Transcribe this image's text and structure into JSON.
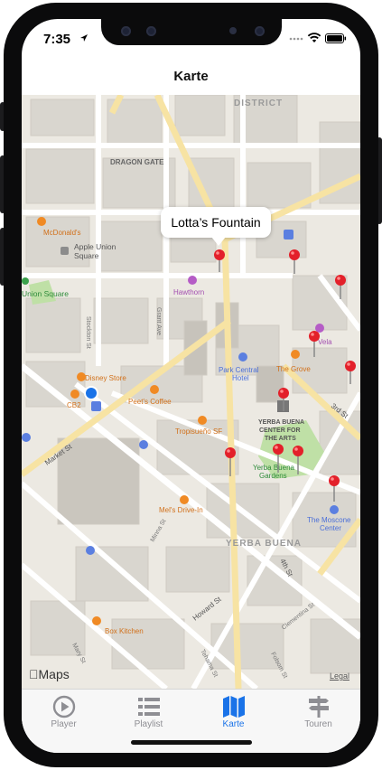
{
  "status_bar": {
    "time": "7:35"
  },
  "nav": {
    "title": "Karte"
  },
  "map": {
    "callout": "Lotta’s Fountain",
    "labels": {
      "district": "DISTRICT",
      "dragon_gate": "DRAGON GATE",
      "mcdonalds": "McDonald's",
      "apple_union_1": "Apple Union",
      "apple_union_2": "Square",
      "union_square": "Union Square",
      "hawthorn": "Hawthorn",
      "grant_ave": "Grant Ave",
      "stockton_st": "Stockton St",
      "park_central_1": "Park Central",
      "park_central_2": "Hotel",
      "the_grove": "The Grove",
      "vela": "Vela",
      "disney_store": "Disney Store",
      "cb2": "CB2",
      "peets": "Peet's Coffee",
      "tropisueno": "Tropisueño SF",
      "ybca_1": "YERBA BUENA",
      "ybca_2": "CENTER FOR",
      "ybca_3": "THE ARTS",
      "ybg_1": "Yerba Buena",
      "ybg_2": "Gardens",
      "third_st": "3rd St",
      "market_st": "Market St",
      "mels": "Mel's Drive-In",
      "yerba_buena": "YERBA BUENA",
      "moscone_1": "The Moscone",
      "moscone_2": "Center",
      "minna_st": "Minna St",
      "fourth_st": "4th St",
      "howard_st": "Howard St",
      "clementina_st": "Clementina St",
      "box_kitchen": "Box Kitchen",
      "mary_st": "Mary St",
      "tehama_st": "Tehama St",
      "folsom_st": "Folsom St"
    },
    "maps_logo": "Maps",
    "legal": "Legal"
  },
  "tabs": [
    {
      "label": "Player",
      "icon": "play-circle-icon",
      "active": false
    },
    {
      "label": "Playlist",
      "icon": "list-icon",
      "active": false
    },
    {
      "label": "Karte",
      "icon": "map-icon",
      "active": true
    },
    {
      "label": "Touren",
      "icon": "signpost-icon",
      "active": false
    }
  ],
  "colors": {
    "accent": "#1a73e8",
    "pin": "#e3202a",
    "inactive_tab": "#8e8e93",
    "park": "#bfe0a6",
    "road_major": "#f7e3a3"
  }
}
